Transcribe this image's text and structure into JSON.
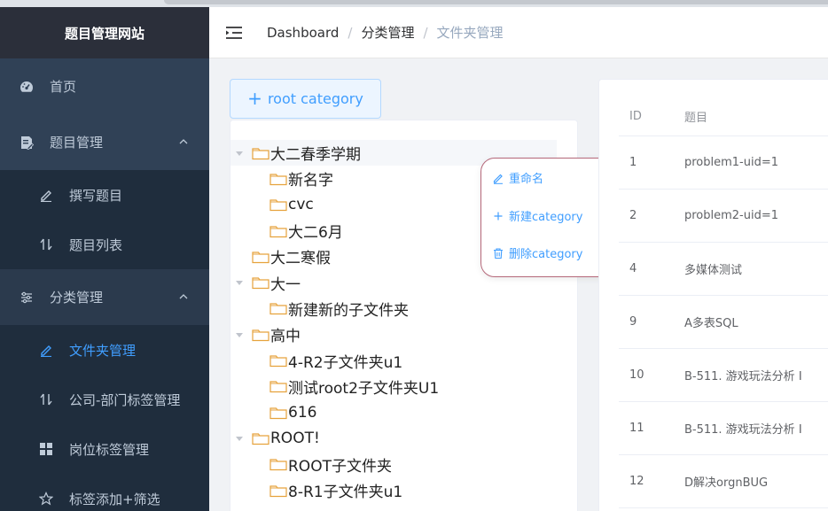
{
  "sidebar": {
    "title": "题目管理网站",
    "items": [
      {
        "label": "首页",
        "icon": "dashboard-icon"
      },
      {
        "label": "题目管理",
        "icon": "edit-document-icon"
      },
      {
        "label": "撰写题目",
        "icon": "pen-icon"
      },
      {
        "label": "题目列表",
        "icon": "sort-icon"
      },
      {
        "label": "分类管理",
        "icon": "settings-sliders-icon"
      },
      {
        "label": "文件夹管理",
        "icon": "pen-icon"
      },
      {
        "label": "公司-部门标签管理",
        "icon": "sort-icon"
      },
      {
        "label": "岗位标签管理",
        "icon": "grid-icon"
      },
      {
        "label": "标签添加+筛选",
        "icon": "star-icon"
      }
    ]
  },
  "header": {
    "breadcrumb": [
      "Dashboard",
      "分类管理",
      "文件夹管理"
    ]
  },
  "root_button": "root category",
  "tree": [
    {
      "label": "大二春季学期",
      "level": 0,
      "expanded": true
    },
    {
      "label": "新名字",
      "level": 1
    },
    {
      "label": "cvc",
      "level": 1
    },
    {
      "label": "大二6月",
      "level": 1
    },
    {
      "label": "大二寒假",
      "level": 0
    },
    {
      "label": "大一",
      "level": 0,
      "expanded": true
    },
    {
      "label": "新建新的子文件夹",
      "level": 1
    },
    {
      "label": "高中",
      "level": 0,
      "expanded": true
    },
    {
      "label": "4-R2子文件夹u1",
      "level": 1
    },
    {
      "label": "测试root2子文件夹U1",
      "level": 1
    },
    {
      "label": "616",
      "level": 1
    },
    {
      "label": "ROOT!",
      "level": 0,
      "expanded": true
    },
    {
      "label": "ROOT子文件夹",
      "level": 1
    },
    {
      "label": "8-R1子文件夹u1",
      "level": 1
    }
  ],
  "context_menu": {
    "rename": "重命名",
    "new": "新建category",
    "delete": "删除category"
  },
  "table": {
    "headers": [
      "ID",
      "题目"
    ],
    "rows": [
      {
        "id": "1",
        "title": "problem1-uid=1"
      },
      {
        "id": "2",
        "title": "problem2-uid=1"
      },
      {
        "id": "4",
        "title": "多媒体测试"
      },
      {
        "id": "9",
        "title": "A多表SQL"
      },
      {
        "id": "10",
        "title": "B-511. 游戏玩法分析 I"
      },
      {
        "id": "11",
        "title": "B-511. 游戏玩法分析 I"
      },
      {
        "id": "12",
        "title": "D解决orgnBUG"
      }
    ]
  },
  "colors": {
    "sidebar_bg": "#304156",
    "accent": "#409eff",
    "folder": "#e6a23c",
    "context_border": "#b5687a"
  }
}
